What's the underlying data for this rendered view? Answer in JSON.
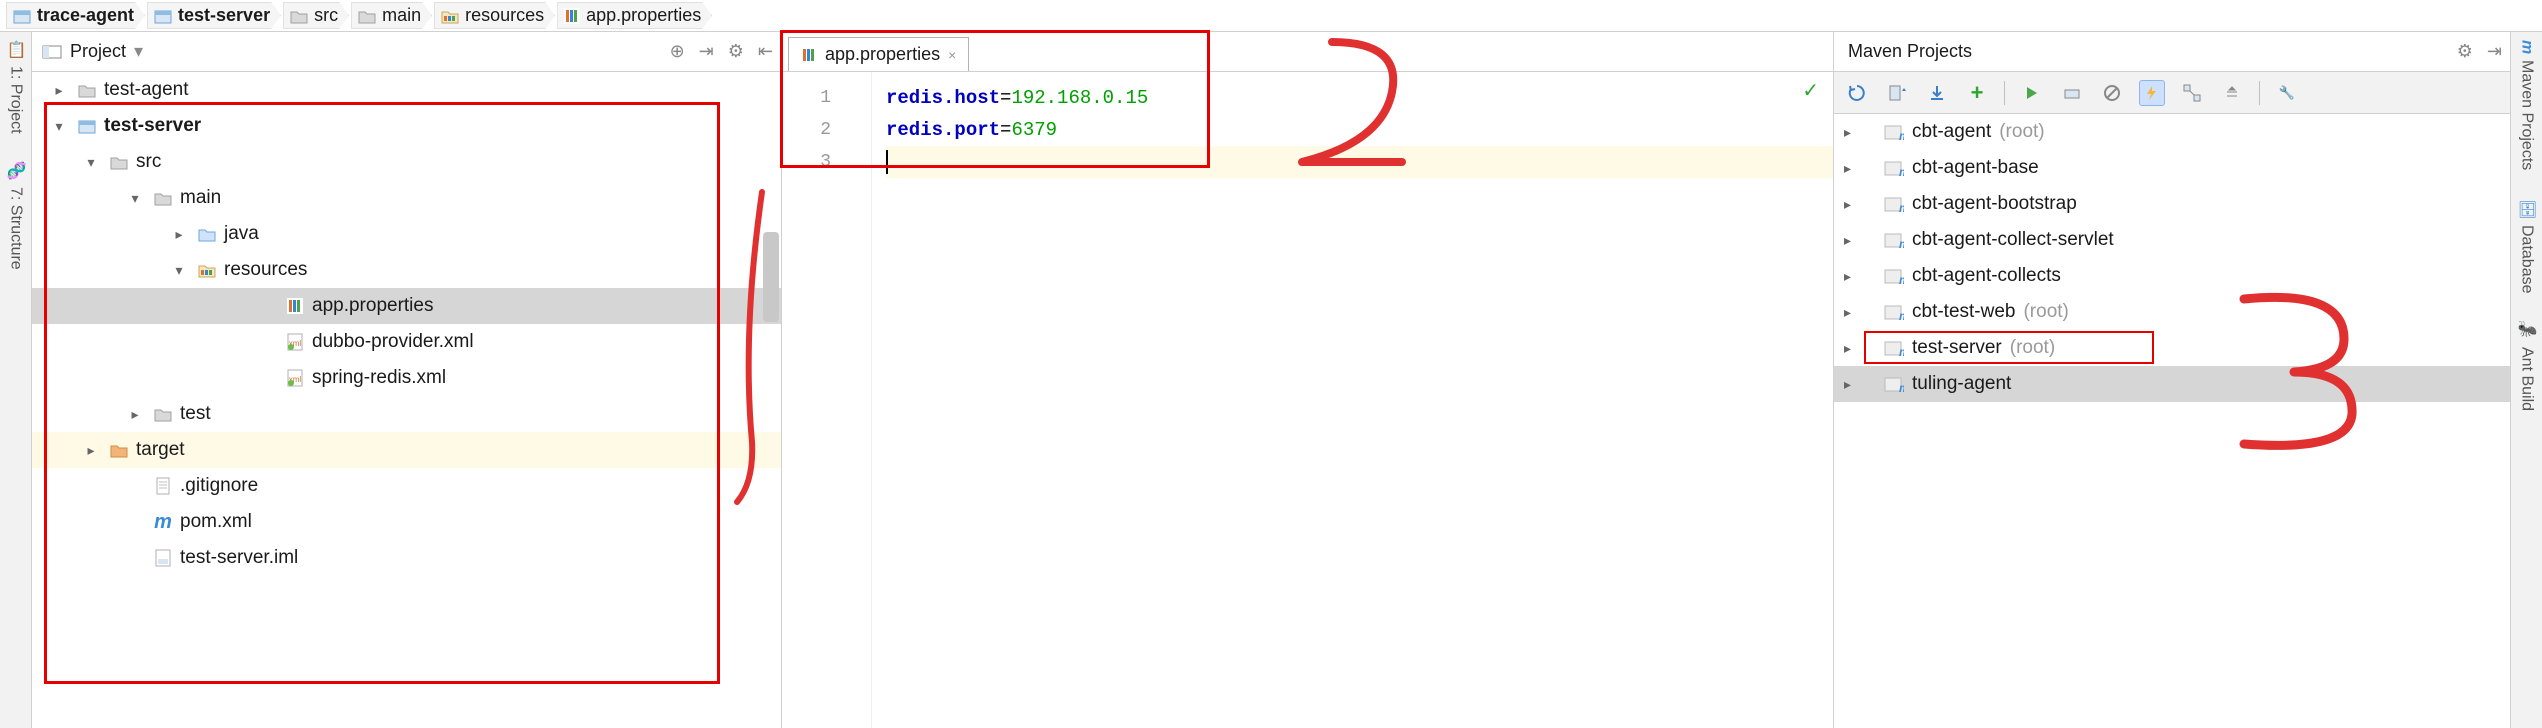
{
  "breadcrumbs": [
    {
      "label": "trace-agent",
      "bold": true,
      "icon": "module"
    },
    {
      "label": "test-server",
      "bold": true,
      "icon": "module"
    },
    {
      "label": "src",
      "bold": false,
      "icon": "folder"
    },
    {
      "label": "main",
      "bold": false,
      "icon": "folder"
    },
    {
      "label": "resources",
      "bold": false,
      "icon": "resources"
    },
    {
      "label": "app.properties",
      "bold": false,
      "icon": "properties"
    }
  ],
  "left_tabs": [
    {
      "label": "1: Project",
      "icon": "project"
    },
    {
      "label": "7: Structure",
      "icon": "structure"
    }
  ],
  "right_tabs": [
    {
      "label": "Maven Projects",
      "icon": "maven",
      "color": "#3b8bd8"
    },
    {
      "label": "Database",
      "icon": "database",
      "color": "#3b8bd8"
    },
    {
      "label": "Ant Build",
      "icon": "ant",
      "color": "#8860d0"
    }
  ],
  "project_panel": {
    "title": "Project",
    "toolbar": [
      "target",
      "collapse",
      "settings",
      "hide"
    ],
    "tree": [
      {
        "indent": 1,
        "chev": ">",
        "icon": "folder",
        "label": "test-agent",
        "bold": false
      },
      {
        "indent": 1,
        "chev": "v",
        "icon": "module",
        "label": "test-server",
        "bold": true
      },
      {
        "indent": 2,
        "chev": "v",
        "icon": "folder",
        "label": "src",
        "bold": false
      },
      {
        "indent": 3,
        "chev": "v",
        "icon": "folder",
        "label": "main",
        "bold": false
      },
      {
        "indent": 4,
        "chev": ">",
        "icon": "folder-blue",
        "label": "java",
        "bold": false
      },
      {
        "indent": 4,
        "chev": "v",
        "icon": "resources",
        "label": "resources",
        "bold": false
      },
      {
        "indent": 6,
        "chev": "",
        "icon": "properties",
        "label": "app.properties",
        "bold": false,
        "selected": true
      },
      {
        "indent": 6,
        "chev": "",
        "icon": "xml",
        "label": "dubbo-provider.xml",
        "bold": false
      },
      {
        "indent": 6,
        "chev": "",
        "icon": "xml",
        "label": "spring-redis.xml",
        "bold": false
      },
      {
        "indent": 3,
        "chev": ">",
        "icon": "folder",
        "label": "test",
        "bold": false
      },
      {
        "indent": 2,
        "chev": ">",
        "icon": "folder-orange",
        "label": "target",
        "bold": false,
        "highlighted": true
      },
      {
        "indent": 3,
        "chev": "",
        "icon": "file",
        "label": ".gitignore",
        "bold": false
      },
      {
        "indent": 3,
        "chev": "",
        "icon": "maven",
        "label": "pom.xml",
        "bold": false
      },
      {
        "indent": 3,
        "chev": "",
        "icon": "iml",
        "label": "test-server.iml",
        "bold": false
      }
    ]
  },
  "editor": {
    "tab_label": "app.properties",
    "status_ok": "✓",
    "gutter": [
      "1",
      "2",
      "3"
    ],
    "lines": [
      {
        "key": "redis.host",
        "value": "192.168.0.15"
      },
      {
        "key": "redis.port",
        "value": "6379"
      }
    ]
  },
  "maven_panel": {
    "title": "Maven Projects",
    "header_tools": [
      "settings",
      "hide"
    ],
    "toolbar": [
      "refresh",
      "generate",
      "download",
      "add",
      "sep",
      "run",
      "profile",
      "skip",
      "offline",
      "expand",
      "collapse",
      "sep",
      "wrench"
    ],
    "tree": [
      {
        "label": "cbt-agent",
        "hint": "(root)"
      },
      {
        "label": "cbt-agent-base",
        "hint": ""
      },
      {
        "label": "cbt-agent-bootstrap",
        "hint": ""
      },
      {
        "label": "cbt-agent-collect-servlet",
        "hint": ""
      },
      {
        "label": "cbt-agent-collects",
        "hint": ""
      },
      {
        "label": "cbt-test-web",
        "hint": "(root)"
      },
      {
        "label": "test-server",
        "hint": "(root)",
        "boxed": true
      },
      {
        "label": "tuling-agent",
        "hint": "",
        "selected": true
      }
    ]
  }
}
